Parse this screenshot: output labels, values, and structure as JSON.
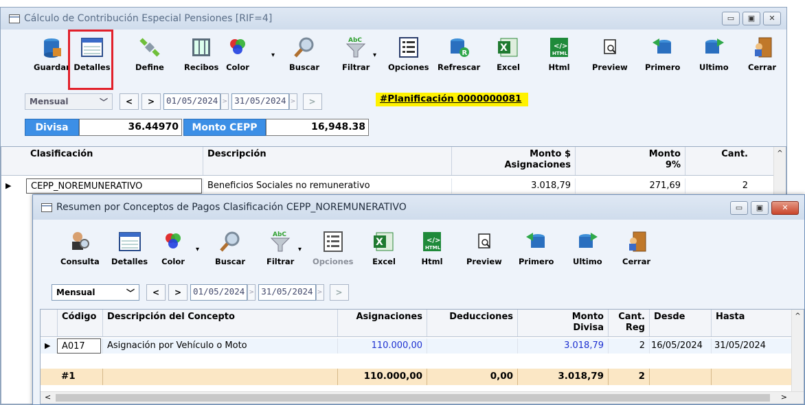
{
  "window1": {
    "title": "Cálculo de Contribución Especial Pensiones [RIF=4]",
    "toolbar": [
      "Guardar",
      "Detalles",
      "Define",
      "Recibos",
      "Color",
      "Buscar",
      "Filtrar",
      "Opciones",
      "Refrescar",
      "Excel",
      "Html",
      "Preview",
      "Primero",
      "Ultimo",
      "Cerrar"
    ],
    "period": "Mensual",
    "prev_label": "<",
    "next_label": ">",
    "date_from": "01/05/2024",
    "date_to": "31/05/2024",
    "nav_extra": ">",
    "planificacion": "#Planificación 0000000081",
    "divisa_label": "Divisa",
    "divisa_value": "36.44970",
    "monto_label": "Monto CEPP",
    "monto_value": "16,948.38",
    "grid": {
      "headers": {
        "clasificacion": "Clasificación",
        "descripcion": "Descripción",
        "monto_a": "Monto $",
        "monto_b": "Asignaciones",
        "monto9_a": "Monto",
        "monto9_b": "9%",
        "cant": "Cant."
      },
      "row": {
        "clasificacion": "CEPP_NOREMUNERATIVO",
        "descripcion": "Beneficios Sociales no remunerativo",
        "monto": "3.018,79",
        "monto9": "271,69",
        "cant": "2"
      }
    }
  },
  "window2": {
    "title": "Resumen por Conceptos de Pagos Clasificación CEPP_NOREMUNERATIVO",
    "toolbar": [
      "Consulta",
      "Detalles",
      "Color",
      "Buscar",
      "Filtrar",
      "Opciones",
      "Excel",
      "Html",
      "Preview",
      "Primero",
      "Ultimo",
      "Cerrar"
    ],
    "period": "Mensual",
    "prev_label": "<",
    "next_label": ">",
    "date_from": "01/05/2024",
    "date_to": "31/05/2024",
    "nav_extra": ">",
    "grid": {
      "headers": {
        "codigo": "Código",
        "descripcion": "Descripción del Concepto",
        "asignaciones": "Asignaciones",
        "deducciones": "Deducciones",
        "monto_a": "Monto",
        "monto_b": "Divisa",
        "cant_a": "Cant.",
        "cant_b": "Reg",
        "desde": "Desde",
        "hasta": "Hasta"
      },
      "row": {
        "codigo": "A017",
        "descripcion": "Asignación por Vehículo o Moto",
        "asignaciones": "110.000,00",
        "deducciones": "",
        "monto": "3.018,79",
        "cant": "2",
        "desde": "16/05/2024",
        "hasta": "31/05/2024"
      },
      "footer": {
        "codigo": "#1",
        "asignaciones": "110.000,00",
        "deducciones": "0,00",
        "monto": "3.018,79",
        "cant": "2"
      }
    }
  },
  "colors": {
    "highlight": "#e2202a",
    "planificacion_bg": "#fff200",
    "label_blue": "#3c8fe6",
    "footer_bg": "#fbe7c5",
    "value_blue": "#1c2fd0"
  }
}
